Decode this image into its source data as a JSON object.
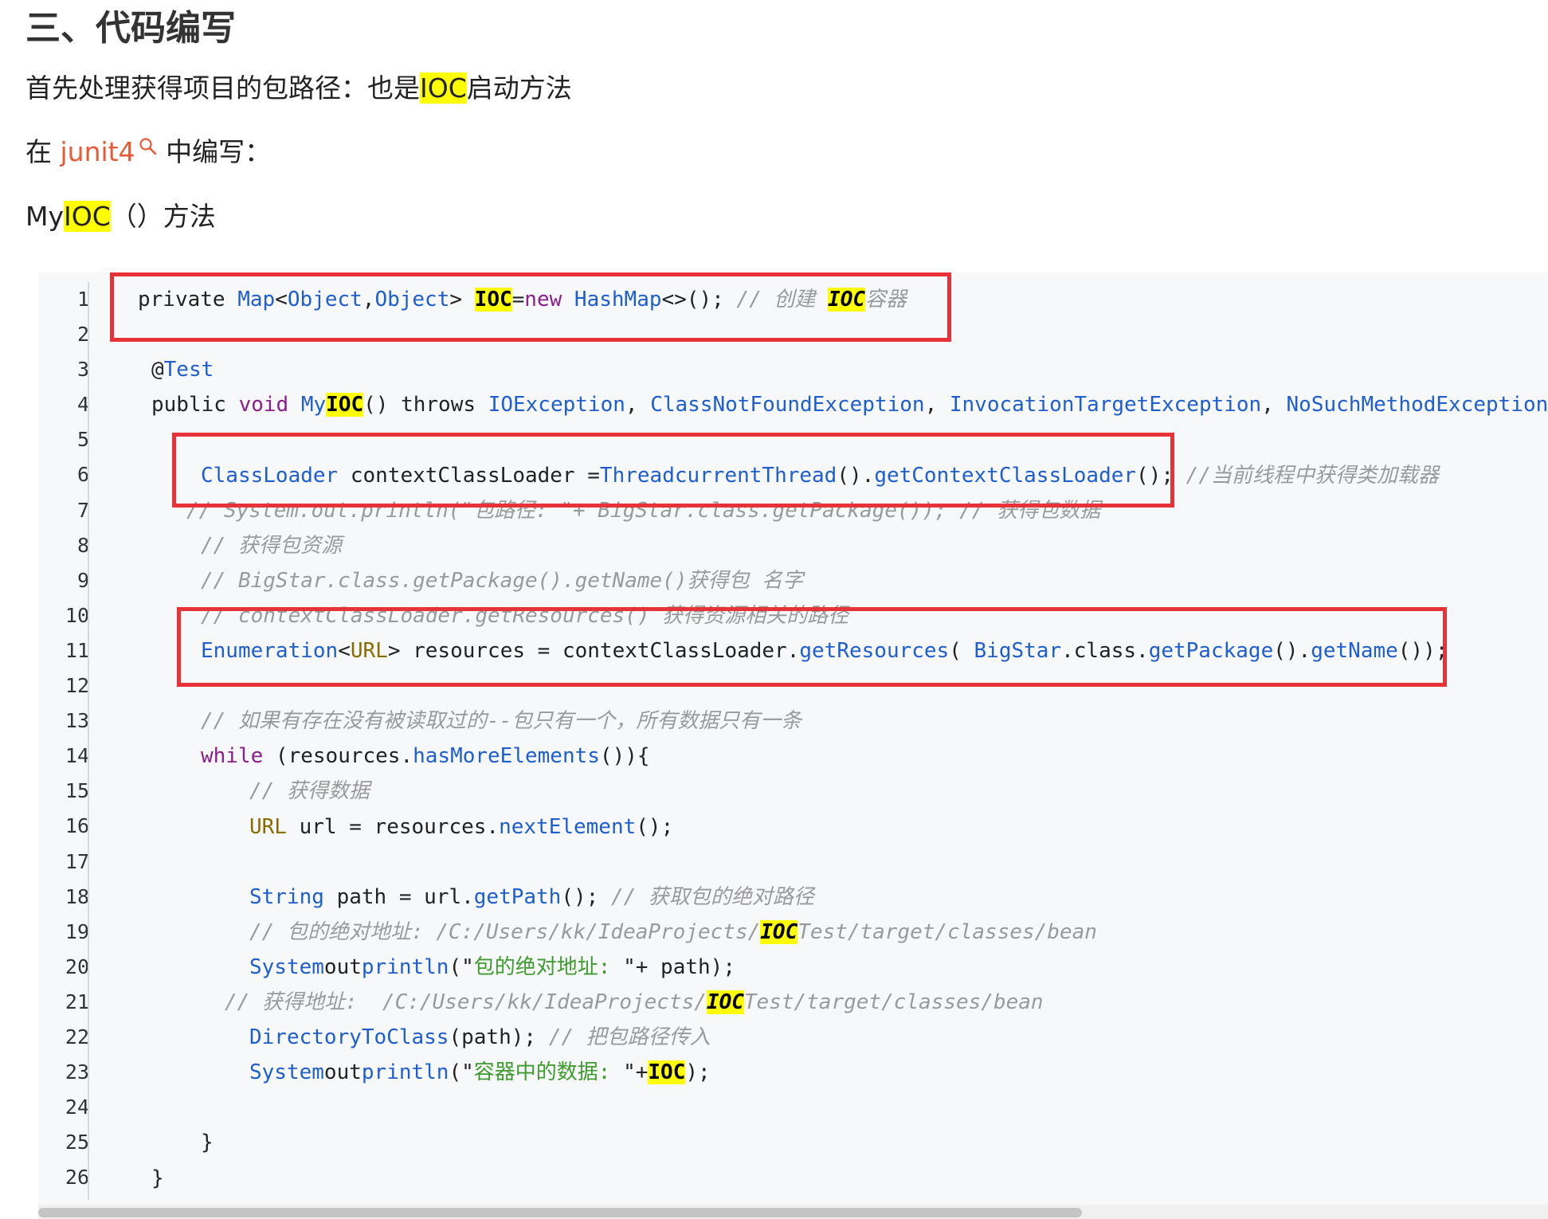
{
  "heading": "三、代码编写",
  "p1": {
    "a": "首先处理获得项目的包路径：也是",
    "hl": "IOC",
    "b": "启动方法"
  },
  "p2": {
    "a": "在 ",
    "link": "junit4",
    "b": " 中编写："
  },
  "p3": {
    "a": "My",
    "hl": "IOC",
    "b": "（）方法"
  },
  "gutter": [
    "1",
    "2",
    "3",
    "4",
    "5",
    "6",
    "7",
    "8",
    "9",
    "10",
    "11",
    "12",
    "13",
    "14",
    "15",
    "16",
    "17",
    "18",
    "19",
    "20",
    "21",
    "22",
    "23",
    "24",
    "25",
    "26"
  ],
  "code": {
    "l1": {
      "a": "private ",
      "b": "Map",
      "c": "<",
      "d": "Object",
      "e": ",",
      "f": "Object",
      "g": "> ",
      "h": "IOC",
      "i": "=",
      "j": "new ",
      "k": "HashMap",
      "l": "<>(); ",
      "m": "// 创建 ",
      "n": "IOC",
      "o": "容器"
    },
    "l3": {
      "a": "@",
      "b": "Test"
    },
    "l4": {
      "a": "public ",
      "b": "void ",
      "c": "My",
      "d": "IOC",
      "e": "() throws ",
      "f": "IOException",
      ",1": ", ",
      "g": "ClassNotFoundException",
      "h": ", ",
      "i": "InvocationTargetException",
      "j": ", ",
      "k": "NoSuchMethodException",
      "l": ","
    },
    "l6": {
      "a": "ClassLoader ",
      "b": "contextClassLoader =",
      "c": "Thread",
      ".": ".",
      "d": "currentThread",
      "e": "().",
      "f": "getContextClassLoader",
      "g": "(); ",
      "h": "//当前线程中获得类加载器"
    },
    "l7": "// System.out.println(\"包路径: \"+ BigStar.class.getPackage()); // 获得包数据",
    "l8": "// 获得包资源",
    "l9": "// BigStar.class.getPackage().getName()获得包 名字",
    "l10": "// contextClassLoader.getResources() 获得资源相关的路径",
    "l11": {
      "a": "Enumeration",
      "b": "<",
      "c": "URL",
      "d": "> resources = contextClassLoader.",
      "e": "getResources",
      "f": "( ",
      "g": "BigStar",
      "h": ".class.",
      "i": "getPackage",
      "j": "().",
      "k": "getName",
      "l": "());"
    },
    "l13": "// 如果有存在没有被读取过的--包只有一个，所有数据只有一条",
    "l14": {
      "a": "while ",
      "b": "(resources.",
      "c": "hasMoreElements",
      "d": "()){"
    },
    "l15": "// 获得数据",
    "l16": {
      "a": "URL ",
      "b": "url = resources.",
      "c": "nextElement",
      "d": "();"
    },
    "l18": {
      "a": "String ",
      "b": "path = url.",
      "c": "getPath",
      "d": "(); ",
      "e": "// 获取包的绝对路径"
    },
    "l19": {
      "a": "// 包的绝对地址: /C:/Users/kk/IdeaProjects/",
      "b": "IOC",
      "c": "Test/target/classes/bean"
    },
    "l20": {
      "a": "System",
      ".": ".",
      "b": "out",
      ".2": ".",
      "c": "println",
      "d": "(\"",
      "e": "包的绝对地址: ",
      "f": "\"+ path);"
    },
    "l21": {
      "a": "// 获得地址:  /C:/Users/kk/IdeaProjects/",
      "b": "IOC",
      "c": "Test/target/classes/bean"
    },
    "l22": {
      "a": "DirectoryToClass",
      "b": "(path); ",
      "c": "// 把包路径传入"
    },
    "l23": {
      "a": "System",
      ".": ".",
      "b": "out",
      ".2": ".",
      "c": "println",
      "d": "(\"",
      "e": "容器中的数据: ",
      "f": "\"+",
      "g": "IOC",
      "h": ");"
    },
    "l25": "}",
    "l26": "}"
  },
  "colors": {
    "highlight": "#ffff00",
    "box": "#e8323a",
    "link": "#e85a37",
    "keyword": "#8a1e8e",
    "type": "#1e5ecf",
    "string": "#3e9b2e",
    "comment": "#9a9a9a"
  }
}
